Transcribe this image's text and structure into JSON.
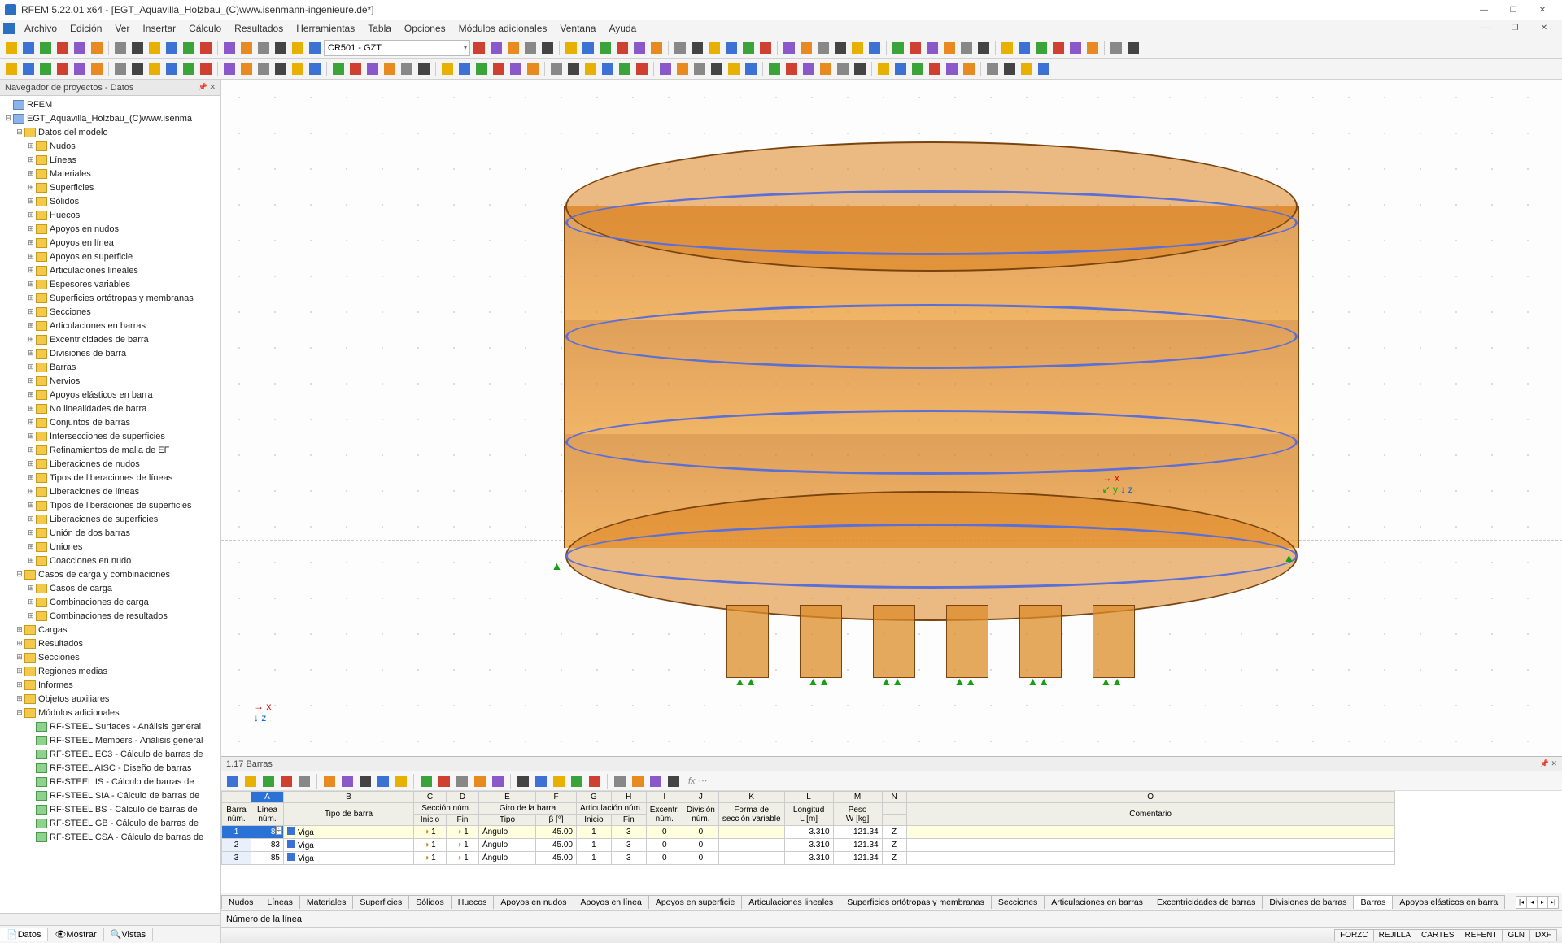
{
  "title": "RFEM 5.22.01 x64 - [EGT_Aquavilla_Holzbau_(C)www.isenmann-ingenieure.de*]",
  "menus": [
    "Archivo",
    "Edición",
    "Ver",
    "Insertar",
    "Cálculo",
    "Resultados",
    "Herramientas",
    "Tabla",
    "Opciones",
    "Módulos adicionales",
    "Ventana",
    "Ayuda"
  ],
  "selector": "CR501 - GZT",
  "nav": {
    "title": "Navegador de proyectos - Datos",
    "root": "RFEM",
    "project": "EGT_Aquavilla_Holzbau_(C)www.isenma",
    "modeldata_label": "Datos del modelo",
    "modeldata": [
      "Nudos",
      "Líneas",
      "Materiales",
      "Superficies",
      "Sólidos",
      "Huecos",
      "Apoyos en nudos",
      "Apoyos en línea",
      "Apoyos en superficie",
      "Articulaciones lineales",
      "Espesores variables",
      "Superficies ortótropas y membranas",
      "Secciones",
      "Articulaciones en barras",
      "Excentricidades de barra",
      "Divisiones de barra",
      "Barras",
      "Nervios",
      "Apoyos elásticos en barra",
      "No linealidades de barra",
      "Conjuntos de barras",
      "Intersecciones de superficies",
      "Refinamientos de malla de EF",
      "Liberaciones de nudos",
      "Tipos de liberaciones de líneas",
      "Liberaciones de líneas",
      "Tipos de liberaciones de superficies",
      "Liberaciones de superficies",
      "Unión de dos barras",
      "Uniones",
      "Coacciones en nudo"
    ],
    "loadcases_label": "Casos de carga y combinaciones",
    "loadcases": [
      "Casos de carga",
      "Combinaciones de carga",
      "Combinaciones de resultados"
    ],
    "extras": [
      "Cargas",
      "Resultados",
      "Secciones",
      "Regiones medias",
      "Informes",
      "Objetos auxiliares"
    ],
    "addmod_label": "Módulos adicionales",
    "addmod": [
      "RF-STEEL Surfaces - Análisis general",
      "RF-STEEL Members - Análisis general",
      "RF-STEEL EC3 - Cálculo de barras de",
      "RF-STEEL AISC - Diseño de barras",
      "RF-STEEL IS - Cálculo de barras de",
      "RF-STEEL SIA - Cálculo de barras de",
      "RF-STEEL BS - Cálculo de barras de",
      "RF-STEEL GB - Cálculo de barras de",
      "RF-STEEL CSA - Cálculo de barras de"
    ],
    "tabs": [
      "Datos",
      "Mostrar",
      "Vistas"
    ]
  },
  "bottom": {
    "title": "1.17 Barras",
    "colLetters": [
      "A",
      "B",
      "C",
      "D",
      "E",
      "F",
      "G",
      "H",
      "I",
      "J",
      "K",
      "L",
      "M",
      "N",
      "O"
    ],
    "group1": {
      "a": "Barra",
      "b": "Línea",
      "cde": "Sección núm.",
      "fg": "Giro de la barra",
      "hi": "Articulación núm.",
      "j": "Excentr.",
      "k": "División",
      "l": "Forma de",
      "m": "Longitud",
      "n": "Peso",
      "o": ""
    },
    "group2": {
      "a": "núm.",
      "b": "núm.",
      "c": "Tipo de barra",
      "d": "Inicio",
      "e": "Fin",
      "f": "Tipo",
      "g": "β [°]",
      "h": "Inicio",
      "i": "Fin",
      "j": "núm.",
      "k": "núm.",
      "l": "sección variable",
      "m": "L [m]",
      "n": "W [kg]",
      "o": "Comentario"
    },
    "rows": [
      {
        "n": "1",
        "linea": "81",
        "tipo": "Viga",
        "ini": "1",
        "fin": "1",
        "giroTipo": "Ángulo",
        "giroB": "45.00",
        "ai": "1",
        "af": "3",
        "ex": "0",
        "div": "0",
        "L": "3.310",
        "W": "121.34",
        "Z": "Z"
      },
      {
        "n": "2",
        "linea": "83",
        "tipo": "Viga",
        "ini": "1",
        "fin": "1",
        "giroTipo": "Ángulo",
        "giroB": "45.00",
        "ai": "1",
        "af": "3",
        "ex": "0",
        "div": "0",
        "L": "3.310",
        "W": "121.34",
        "Z": "Z"
      },
      {
        "n": "3",
        "linea": "85",
        "tipo": "Viga",
        "ini": "1",
        "fin": "1",
        "giroTipo": "Ángulo",
        "giroB": "45.00",
        "ai": "1",
        "af": "3",
        "ex": "0",
        "div": "0",
        "L": "3.310",
        "W": "121.34",
        "Z": "Z"
      }
    ],
    "tabs": [
      "Nudos",
      "Líneas",
      "Materiales",
      "Superficies",
      "Sólidos",
      "Huecos",
      "Apoyos en nudos",
      "Apoyos en línea",
      "Apoyos en superficie",
      "Articulaciones lineales",
      "Superficies ortótropas y membranas",
      "Secciones",
      "Articulaciones en barras",
      "Excentricidades de barras",
      "Divisiones de barras",
      "Barras",
      "Apoyos elásticos en barra"
    ],
    "active_tab": "Barras"
  },
  "status": "Número de la línea",
  "toggles": [
    "FORZC",
    "REJILLA",
    "CARTES",
    "REFENT",
    "GLN",
    "DXF"
  ]
}
